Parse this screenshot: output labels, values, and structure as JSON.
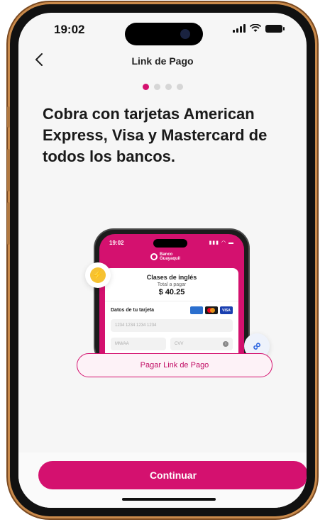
{
  "status_bar": {
    "time": "19:02"
  },
  "nav": {
    "title": "Link de Pago"
  },
  "pager": {
    "dots": 4,
    "active_index": 0
  },
  "headline": "Cobra con tarjetas American Express, Visa y Mastercard de todos los bancos.",
  "illustration": {
    "phone_time": "19:02",
    "bank_name_line1": "Banco",
    "bank_name_line2": "Guayaquil",
    "card_title": "Clases de inglés",
    "total_label": "Total a pagar",
    "amount": "$ 40.25",
    "card_section_label": "Datos de tu tarjeta",
    "card_brands": [
      "AMEX",
      "Mastercard",
      "VISA"
    ],
    "card_number_placeholder": "1234 1234 1234 1234",
    "expiry_placeholder": "MM/AA",
    "cvv_placeholder": "CVV",
    "pay_link_button": "Pagar Link de Pago",
    "visa_label": "VISA"
  },
  "footer": {
    "continue_label": "Continuar"
  },
  "colors": {
    "accent": "#d4116f",
    "link_badge": "#2f66e0",
    "bolt": "#f6c232"
  }
}
